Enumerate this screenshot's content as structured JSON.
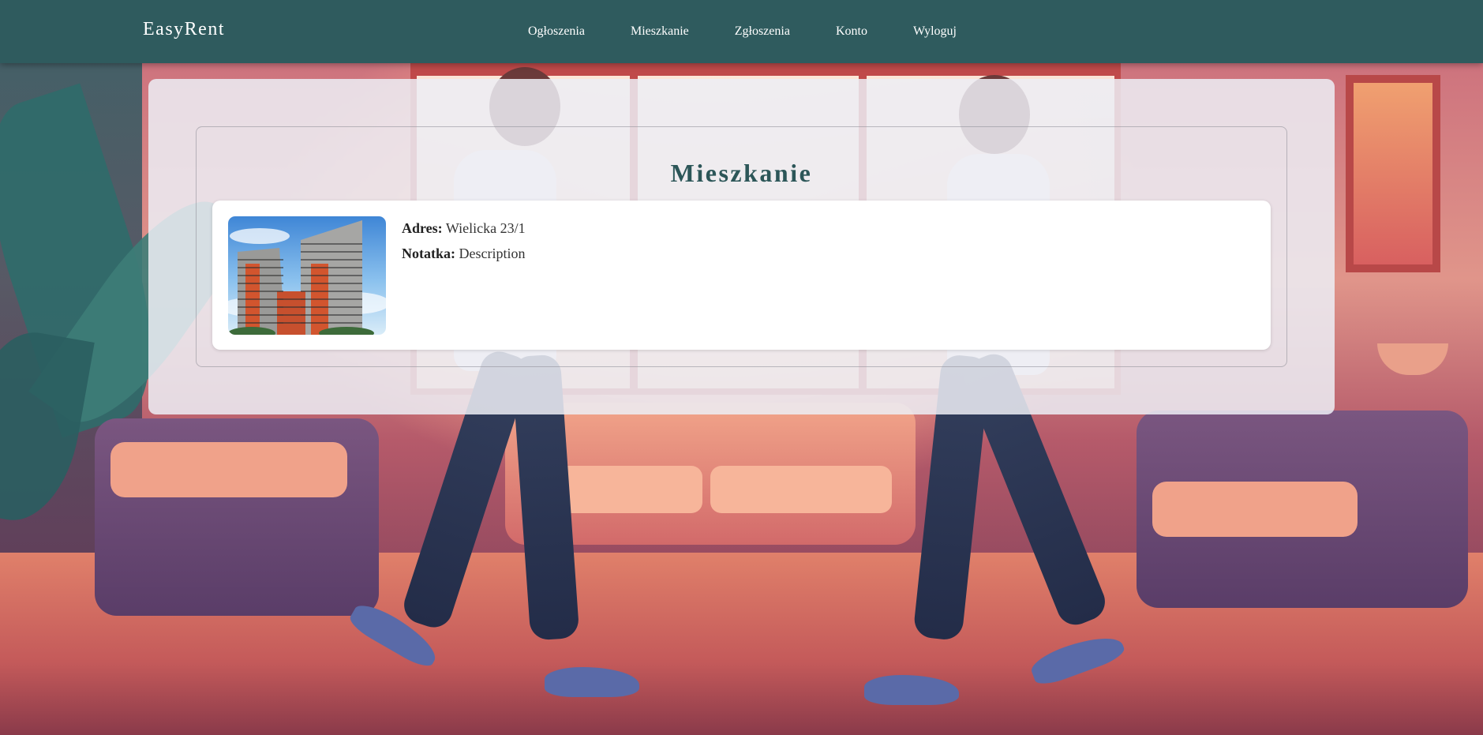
{
  "navbar": {
    "brand": "EasyRent",
    "links": [
      {
        "label": "Ogłoszenia"
      },
      {
        "label": "Mieszkanie"
      },
      {
        "label": "Zgłoszenia"
      },
      {
        "label": "Konto"
      },
      {
        "label": "Wyloguj"
      }
    ],
    "background_color": "#2f5b5e"
  },
  "main": {
    "title": "Mieszkanie",
    "title_color": "#2c5658",
    "apartment": {
      "address_label": "Adres:",
      "address_value": "Wielicka 23/1",
      "note_label": "Notatka:",
      "note_value": "Description",
      "photo_icon": "apartment-building-photo"
    }
  }
}
